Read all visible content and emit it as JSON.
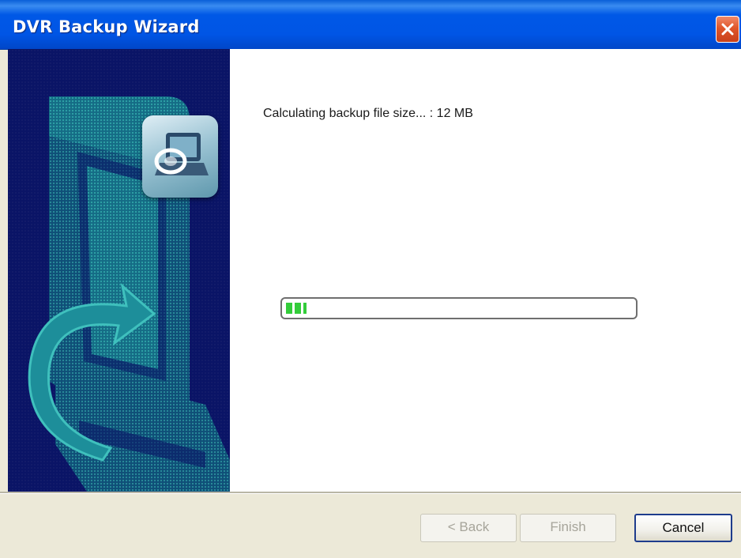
{
  "window": {
    "title": "DVR Backup Wizard"
  },
  "titlebar": {
    "close_icon": "close-x-icon",
    "close_color": "#e0562a"
  },
  "banner": {
    "background_color": "#0a1466",
    "illustration": "dvr-backup-illustration",
    "icon": "computer-disk-icon"
  },
  "main": {
    "status_text": "Calculating backup file size... : 12 MB",
    "progress": {
      "fraction": 0.06,
      "fill_color": "#33cc3a"
    }
  },
  "buttons": {
    "back_label": "< Back",
    "finish_label": "Finish",
    "cancel_label": "Cancel"
  }
}
